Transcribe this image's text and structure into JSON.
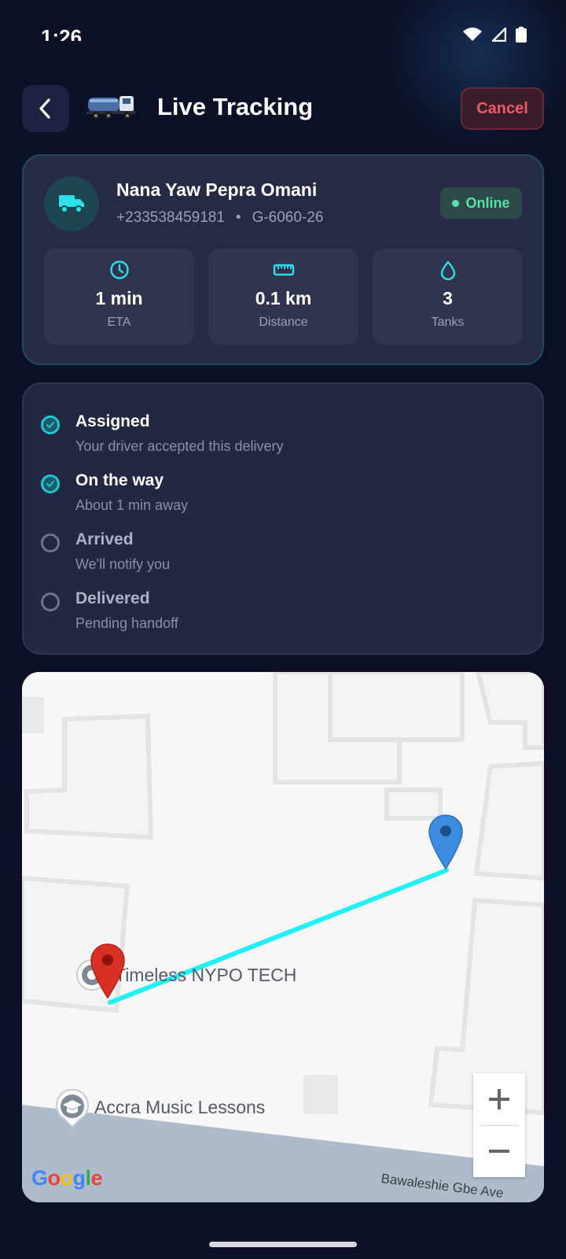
{
  "status_bar": {
    "time": "1:26"
  },
  "header": {
    "title": "Live Tracking",
    "cancel_label": "Cancel"
  },
  "driver": {
    "name": "Nana Yaw Pepra Omani",
    "phone": "+233538459181",
    "separator": "•",
    "plate": "G-6060-26",
    "status": "Online",
    "status_color": "#58e0a8"
  },
  "stats": [
    {
      "icon": "clock-icon",
      "value": "1 min",
      "label": "ETA"
    },
    {
      "icon": "ruler-icon",
      "value": "0.1 km",
      "label": "Distance"
    },
    {
      "icon": "water-drop-icon",
      "value": "3",
      "label": "Tanks"
    }
  ],
  "steps": [
    {
      "title": "Assigned",
      "subtitle": "Your driver accepted this delivery",
      "done": true
    },
    {
      "title": "On the way",
      "subtitle": "About 1 min away",
      "done": true
    },
    {
      "title": "Arrived",
      "subtitle": "We'll notify you",
      "done": false
    },
    {
      "title": "Delivered",
      "subtitle": "Pending handoff",
      "done": false
    }
  ],
  "map": {
    "place_1": "Timeless NYPO TECH",
    "place_2": "Accra Music Lessons",
    "street": "Bawaleshie Gbe Ave",
    "provider": "Google",
    "zoom_in": "+",
    "zoom_out": "−",
    "route_color": "#22f0f7",
    "driver_pin_color": "#3b8de0",
    "destination_pin_color": "#d93025"
  },
  "colors": {
    "accent": "#1fc6d6",
    "background": "#0b1026",
    "cancel": "#ef5a68"
  }
}
